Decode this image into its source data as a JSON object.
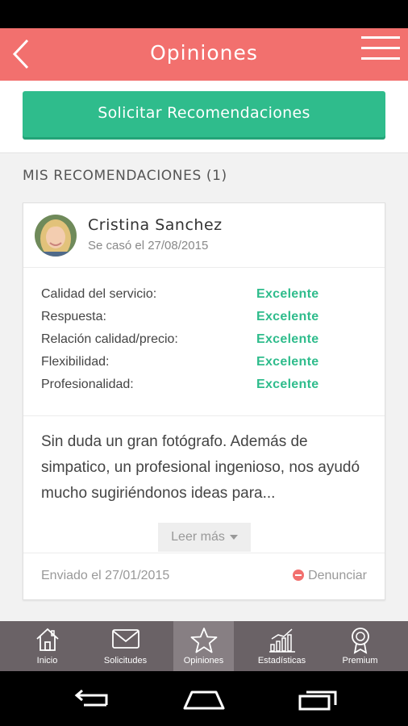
{
  "header": {
    "title": "Opiniones",
    "back_icon": "chevron-left-icon",
    "menu_icon": "hamburger-icon",
    "color": "#f2706e"
  },
  "actions": {
    "request_label": "Solicitar Recomendaciones",
    "accent": "#2fbc8c"
  },
  "section": {
    "title": "MIS RECOMENDACIONES (1)"
  },
  "recommendation": {
    "name": "Cristina Sanchez",
    "wedding": "Se casó el 27/08/2015",
    "ratings": [
      {
        "label": "Calidad del servicio:",
        "value": "Excelente"
      },
      {
        "label": "Respuesta:",
        "value": "Excelente"
      },
      {
        "label": "Relación calidad/precio:",
        "value": "Excelente"
      },
      {
        "label": "Flexibilidad:",
        "value": "Excelente"
      },
      {
        "label": "Profesionalidad:",
        "value": "Excelente"
      }
    ],
    "text": "Sin duda un gran fotógrafo. Además de simpatico, un profesional ingenioso, nos ayudó mucho sugiriéndonos ideas para...",
    "read_more": "Leer más",
    "sent": "Enviado el 27/01/2015",
    "report": "Denunciar"
  },
  "tabs": [
    {
      "label": "Inicio",
      "icon": "home-icon",
      "active": false
    },
    {
      "label": "Solicitudes",
      "icon": "envelope-icon",
      "active": false
    },
    {
      "label": "Opiniones",
      "icon": "star-icon",
      "active": true
    },
    {
      "label": "Estadísticas",
      "icon": "bar-chart-icon",
      "active": false
    },
    {
      "label": "Premium",
      "icon": "award-icon",
      "active": false
    }
  ]
}
